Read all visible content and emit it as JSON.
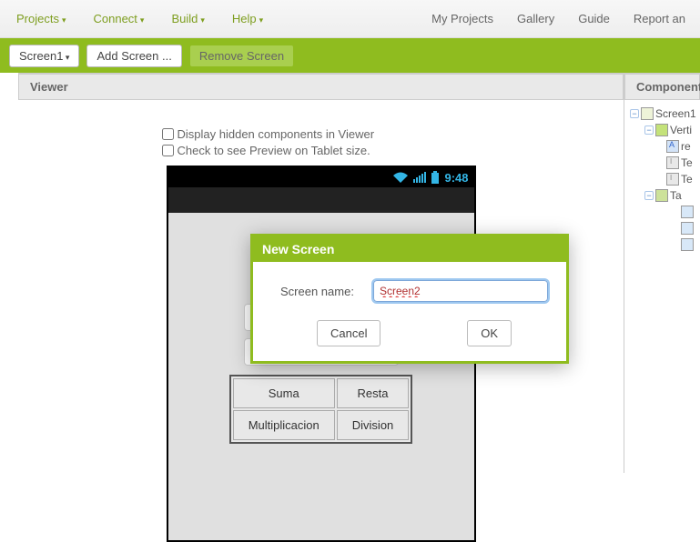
{
  "topMenu": {
    "left": [
      "Projects",
      "Connect",
      "Build",
      "Help"
    ],
    "right": [
      "My Projects",
      "Gallery",
      "Guide",
      "Report an"
    ]
  },
  "greenbar": {
    "screenBtn": "Screen1",
    "addScreen": "Add Screen ...",
    "removeScreen": "Remove Screen"
  },
  "viewer": {
    "title": "Viewer",
    "check1": "Display hidden components in Viewer",
    "check2": "Check to see Preview on Tablet size.",
    "clock": "9:48",
    "ops": {
      "r1c1": "Suma",
      "r1c2": "Resta",
      "r2c1": "Multiplicacion",
      "r2c2": "Division"
    }
  },
  "components": {
    "title": "Components",
    "items": {
      "screen": "Screen1",
      "vert": "Verti",
      "a": "re",
      "t1": "Te",
      "t2": "Te",
      "table": "Ta"
    }
  },
  "modal": {
    "title": "New Screen",
    "label": "Screen name:",
    "value": "Screen2",
    "cancel": "Cancel",
    "ok": "OK"
  }
}
